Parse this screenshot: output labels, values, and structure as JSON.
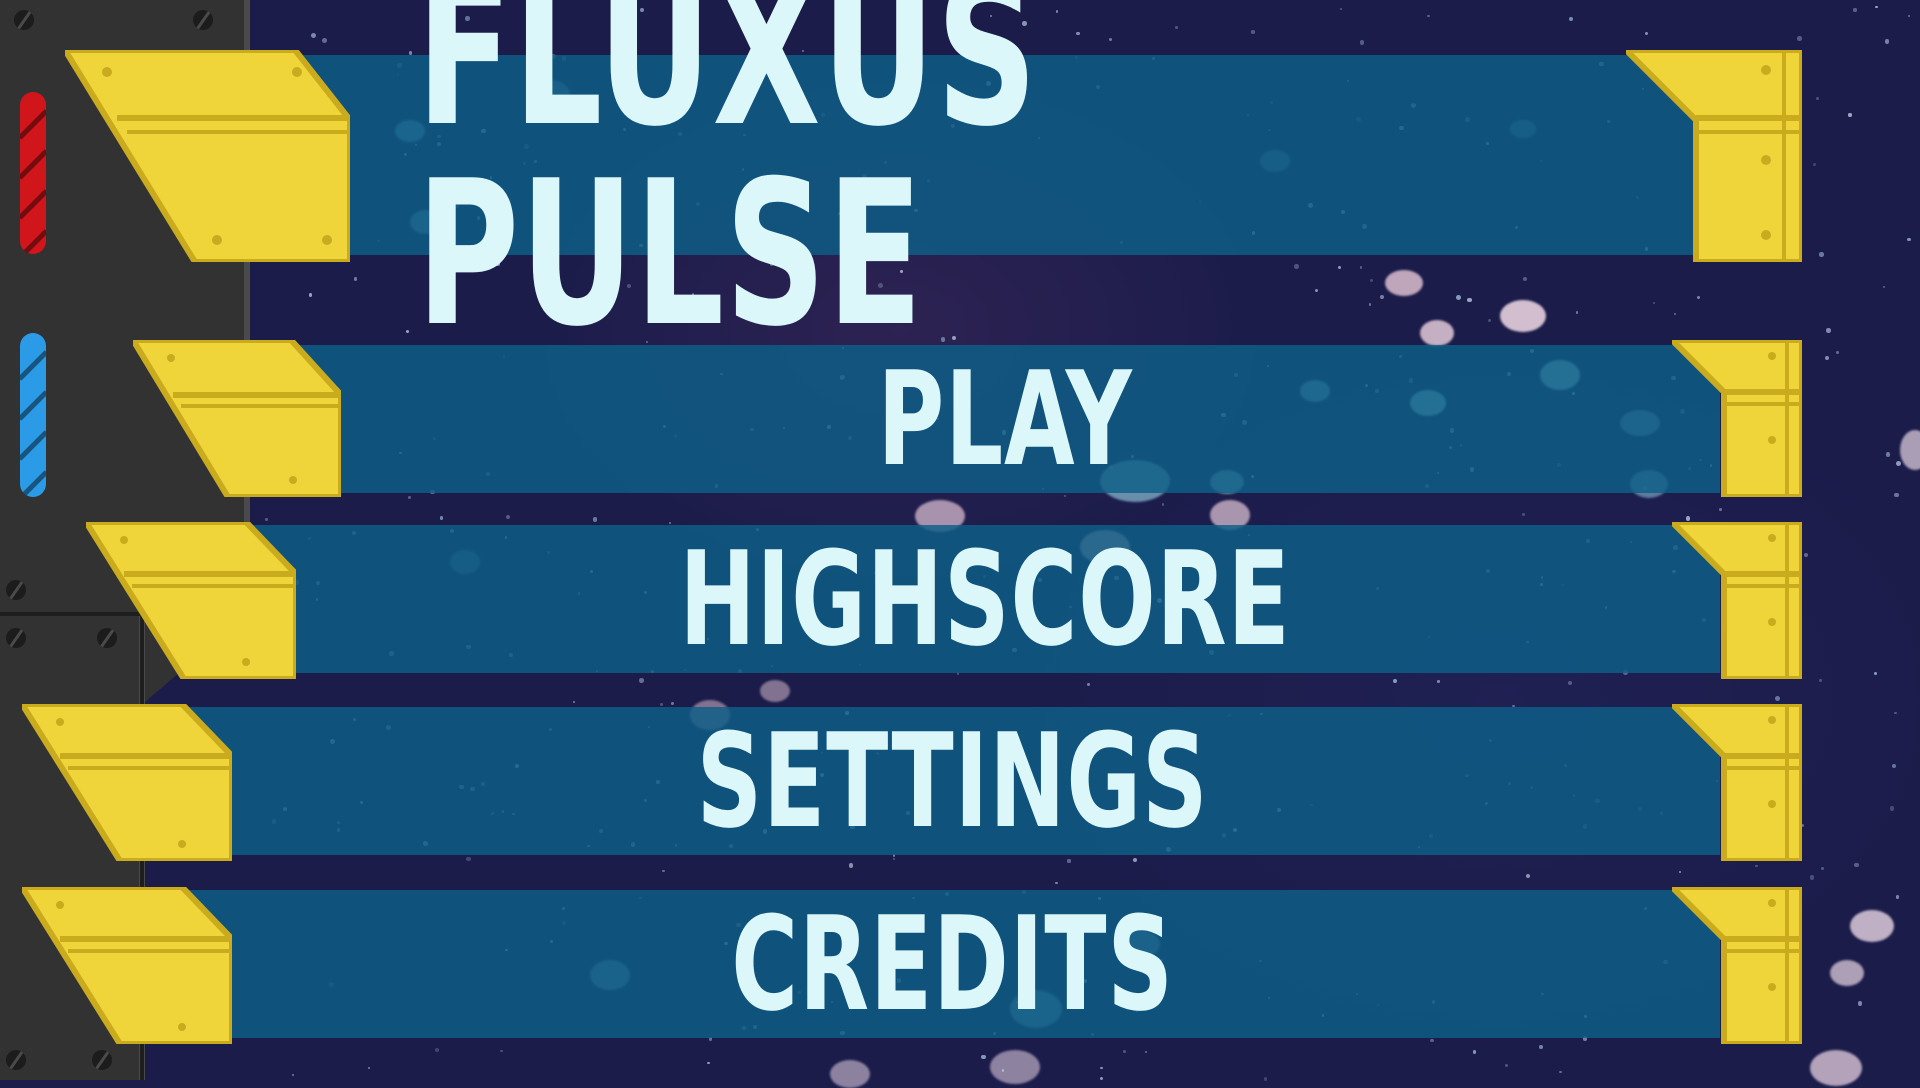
{
  "title": "FLUXUS PULSE",
  "menu": {
    "play_label": "PLAY",
    "highscore_label": "HIGHSCORE",
    "settings_label": "SETTINGS",
    "credits_label": "CREDITS"
  },
  "colors": {
    "bar": "#0e5f87",
    "text": "#dcf7f9",
    "cap": "#f0d53a",
    "background": "#1b1c4a",
    "panel": "#323232",
    "light_red": "#d1161b",
    "light_blue": "#2b9be8"
  },
  "icons": [
    "red-status-light-icon",
    "blue-status-light-icon",
    "screw-icon"
  ]
}
